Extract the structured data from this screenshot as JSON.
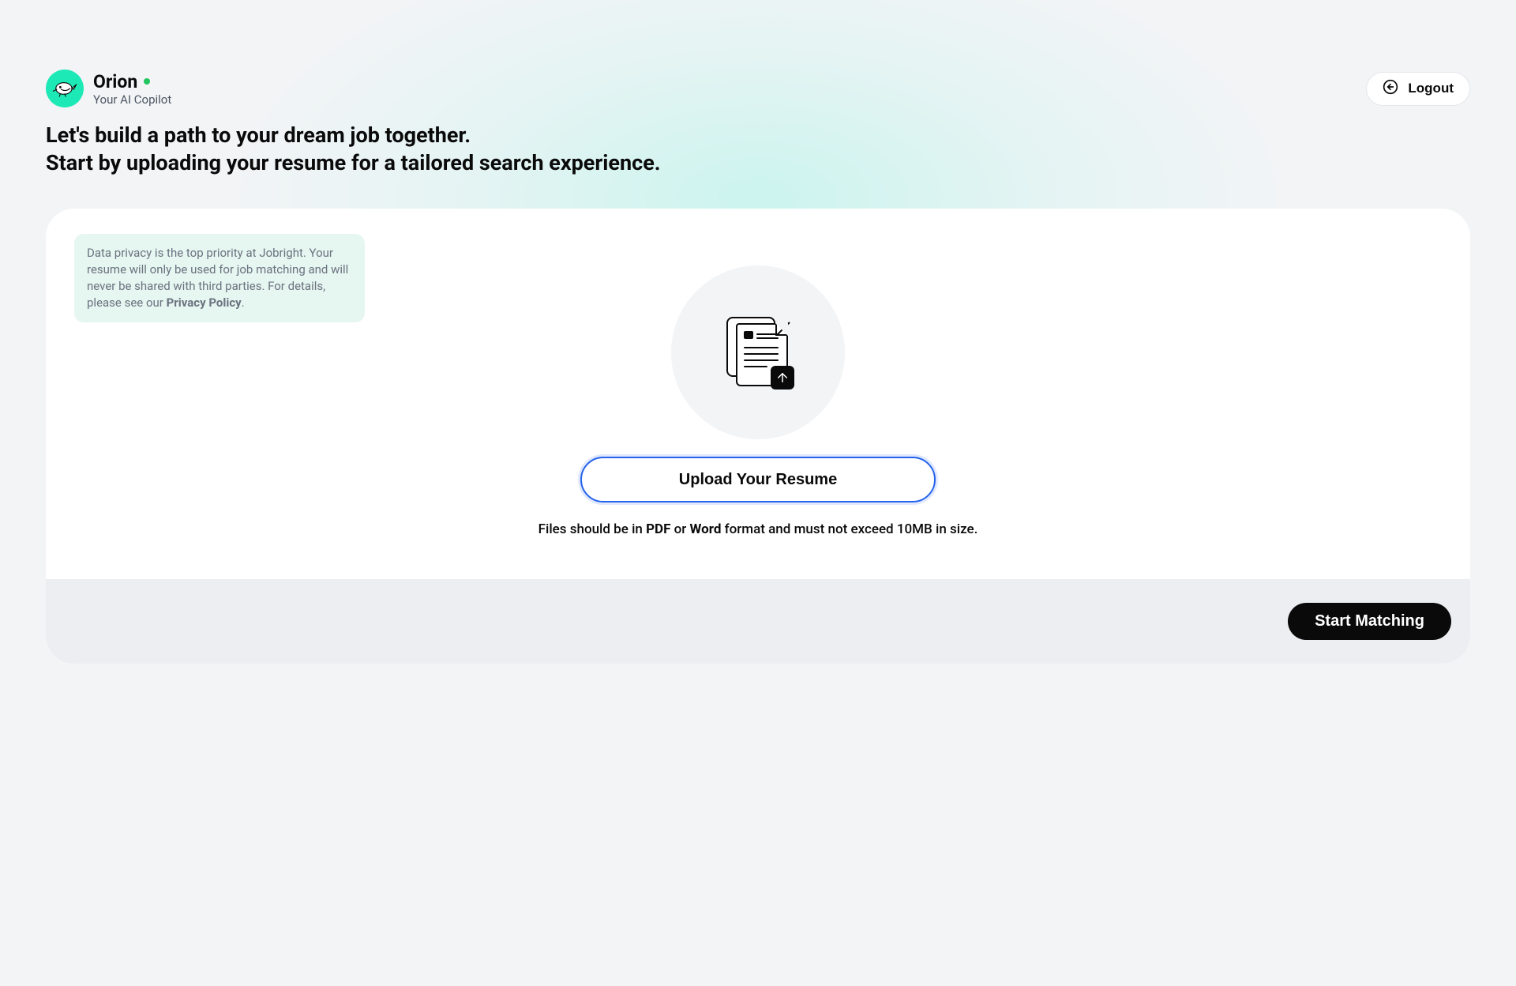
{
  "header": {
    "brand_name": "Orion",
    "brand_subtitle": "Your AI Copilot",
    "logout_label": "Logout"
  },
  "headline": {
    "line1": "Let's build a path to your dream job together.",
    "line2": "Start by uploading your resume for a tailored search experience."
  },
  "privacy": {
    "text_before": "Data privacy is the top priority at Jobright. Your resume will only be used for job matching and will never be shared with third parties. For details, please see our ",
    "policy_label": "Privacy Policy",
    "text_after": "."
  },
  "upload": {
    "button_label": "Upload Your Resume",
    "hint_before": "Files should be in ",
    "hint_pdf": "PDF",
    "hint_middle": " or ",
    "hint_word": "Word",
    "hint_after": " format and must not exceed 10MB in size."
  },
  "footer": {
    "start_matching_label": "Start Matching"
  }
}
